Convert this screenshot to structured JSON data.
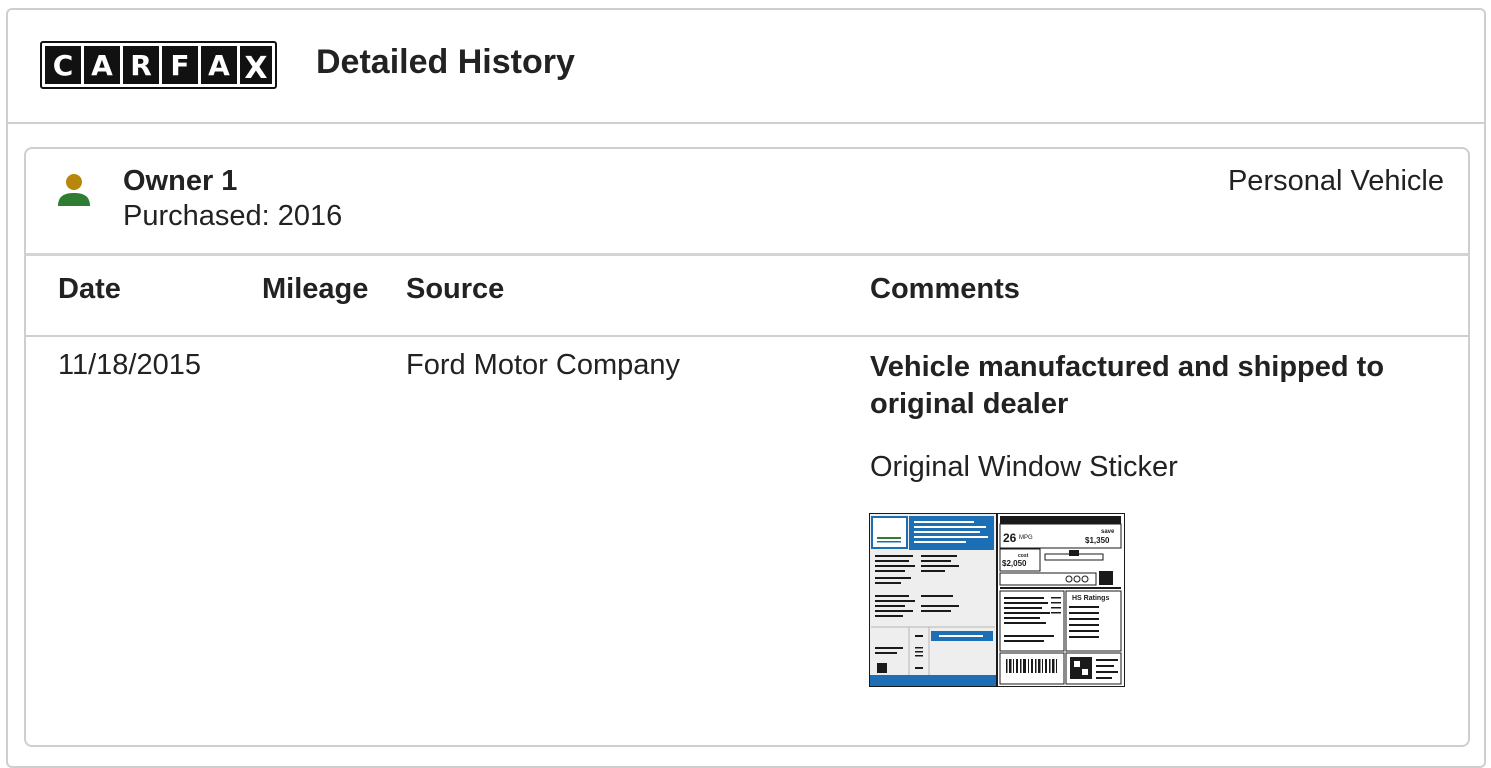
{
  "header": {
    "logo_letters": [
      "C",
      "A",
      "R",
      "F",
      "A",
      "X"
    ],
    "title": "Detailed History"
  },
  "owner": {
    "name": "Owner 1",
    "purchased": "Purchased: 2016",
    "vehicle_type": "Personal Vehicle",
    "icon": "person-icon",
    "icon_colors": {
      "head": "#b8860b",
      "body": "#2e7d32"
    }
  },
  "table": {
    "columns": [
      "Date",
      "Mileage",
      "Source",
      "Comments"
    ],
    "rows": [
      {
        "date": "11/18/2015",
        "mileage": "",
        "source": "Ford Motor Company",
        "comment": "Vehicle manufactured and shipped to original dealer",
        "link": "Original Window Sticker"
      }
    ]
  },
  "sticker": {
    "mpg": "26",
    "mpg_unit": "MPG",
    "save_label": "save",
    "save": "$1,350",
    "cost_label": "cost",
    "cost": "$2,050",
    "ratings_label": "HS Ratings",
    "colors": {
      "accent": "#1c6fb5",
      "frame": "#1a1a1a",
      "panel": "#eeeeee"
    }
  }
}
